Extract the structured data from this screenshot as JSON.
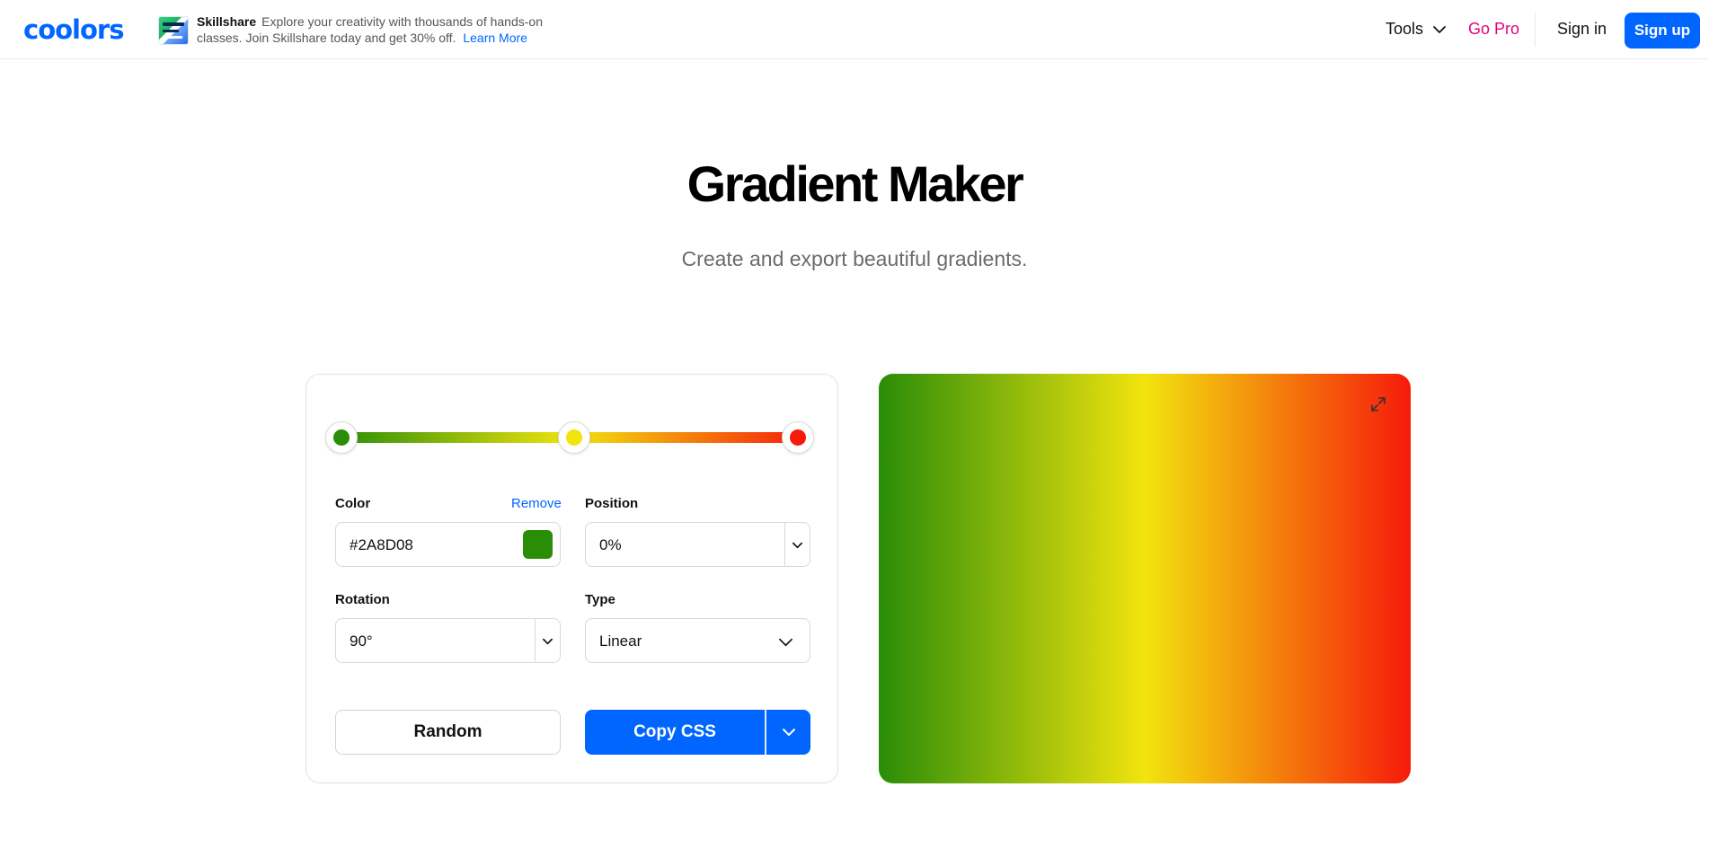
{
  "header": {
    "logo": "coolors",
    "ad": {
      "brand": "Skillshare",
      "text": "Explore your creativity with thousands of hands-on classes. Join Skillshare today and get 30% off.",
      "link": "Learn More"
    },
    "nav": {
      "tools": "Tools",
      "go_pro": "Go Pro",
      "sign_in": "Sign in",
      "sign_up": "Sign up"
    }
  },
  "hero": {
    "title": "Gradient Maker",
    "subtitle": "Create and export beautiful gradients."
  },
  "editor": {
    "stops": [
      {
        "color": "#2A8D08",
        "position": 0
      },
      {
        "color": "#F2E40E",
        "position": 50
      },
      {
        "color": "#F61A0B",
        "position": 100
      }
    ],
    "color_label": "Color",
    "remove_label": "Remove",
    "color_value": "#2A8D08",
    "position_label": "Position",
    "position_value": "0%",
    "rotation_label": "Rotation",
    "rotation_value": "90°",
    "type_label": "Type",
    "type_value": "Linear",
    "random_label": "Random",
    "copy_label": "Copy CSS"
  },
  "colors": {
    "accent": "#0066FF",
    "go_pro": "#E6007E"
  },
  "icons": {
    "tools_chevron": "chevron-down-icon",
    "expand": "expand-icon"
  }
}
